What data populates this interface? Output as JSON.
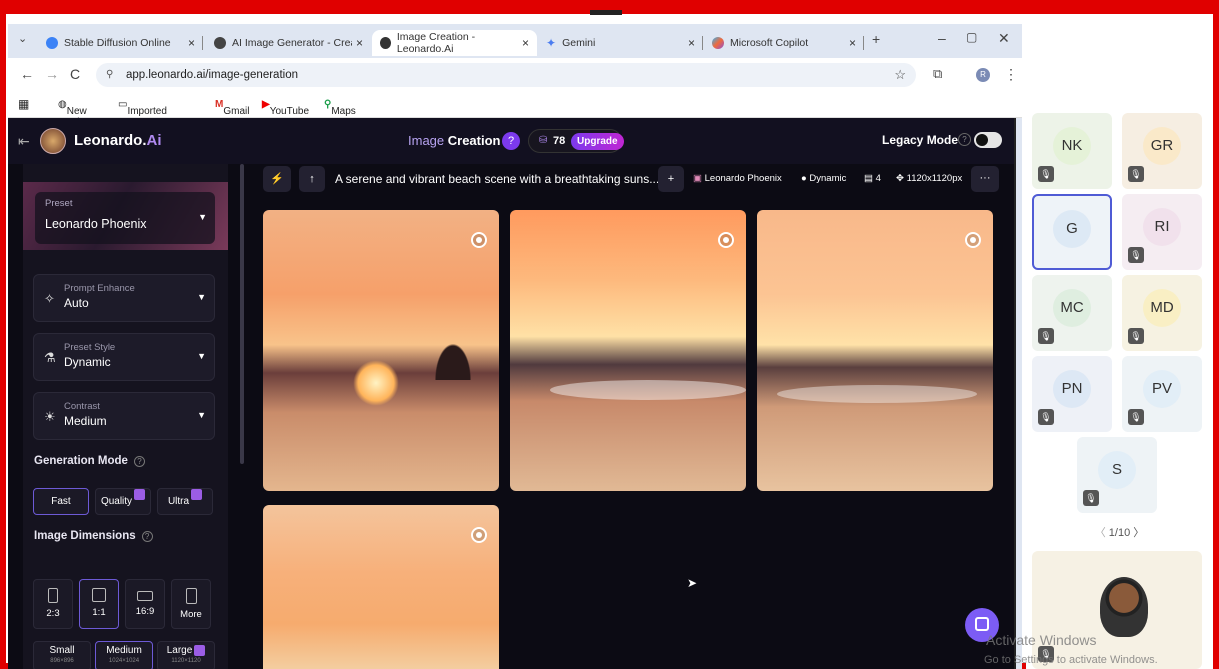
{
  "browser": {
    "tabs": [
      {
        "label": "Stable Diffusion Online",
        "close": "×"
      },
      {
        "label": "AI Image Generator - Create A",
        "close": "×"
      },
      {
        "label": "Image Creation - Leonardo.Ai",
        "close": "×"
      },
      {
        "label": "Gemini",
        "close": "×"
      },
      {
        "label": "Microsoft Copilot",
        "close": "×"
      }
    ],
    "new_tab": "+",
    "url": "app.leonardo.ai/image-generation",
    "profile_initial": "R",
    "bookmarks": [
      "New Tab",
      "Imported From IE",
      "Gmail",
      "YouTube",
      "Maps"
    ]
  },
  "app": {
    "logo_text": "Leonardo.",
    "logo_suffix": "Ai",
    "page_title_a": "Image ",
    "page_title_b": "Creation",
    "tokens": "78",
    "upgrade": "Upgrade",
    "legacy_mode": "Legacy Mode",
    "preset": {
      "label": "Preset",
      "value": "Leonardo Phoenix"
    },
    "prompt_enhance": {
      "label": "Prompt Enhance",
      "value": "Auto"
    },
    "preset_style": {
      "label": "Preset Style",
      "value": "Dynamic"
    },
    "contrast": {
      "label": "Contrast",
      "value": "Medium"
    },
    "generation_mode": {
      "title": "Generation Mode",
      "fast": "Fast",
      "quality": "Quality",
      "ultra": "Ultra"
    },
    "image_dimensions": {
      "title": "Image Dimensions",
      "ratios": [
        "2:3",
        "1:1",
        "16:9",
        "More"
      ],
      "sizes": [
        {
          "label": "Small",
          "px": "896×896"
        },
        {
          "label": "Medium",
          "px": "1024×1024"
        },
        {
          "label": "Large",
          "px": "1120×1120"
        }
      ]
    },
    "prompt": "A serene and vibrant beach scene with a breathtaking suns...",
    "prompt_model": "Leonardo Phoenix",
    "prompt_style": "Dynamic",
    "prompt_count": "4",
    "prompt_size": "1120x1120px",
    "prompt_more": "···"
  },
  "meeting": {
    "participants": [
      {
        "initials": "NK",
        "color": "#e5f2d8"
      },
      {
        "initials": "GR",
        "color": "#fae9c9"
      },
      {
        "initials": "G",
        "color": "#dde9f5"
      },
      {
        "initials": "RI",
        "color": "#f1e1ec"
      },
      {
        "initials": "MC",
        "color": "#dfeee0"
      },
      {
        "initials": "MD",
        "color": "#f9efc4"
      },
      {
        "initials": "PN",
        "color": "#dde8f5"
      },
      {
        "initials": "PV",
        "color": "#e2eef7"
      },
      {
        "initials": "S",
        "color": "#e2eef7"
      }
    ],
    "pagination": "1/10"
  },
  "os": {
    "activate_title": "Activate Windows",
    "activate_sub": "Go to Settings to activate Windows."
  }
}
